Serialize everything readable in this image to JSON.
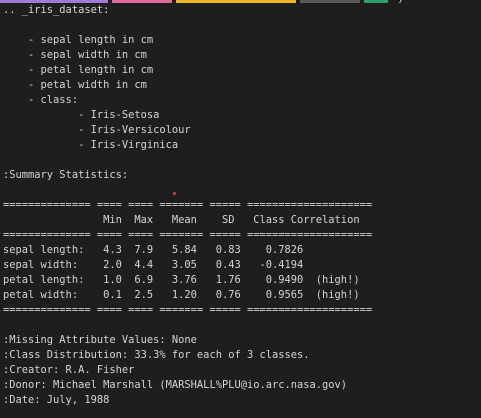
{
  "theme": {
    "background": "#1e1e1e",
    "text": "#d4d4d4",
    "marker": "#e03c3c",
    "tab_colors": [
      "#9d7cd8",
      "#e06c9f",
      "#f0b429",
      "#5a5a5a",
      "#2e9e6b"
    ]
  },
  "tab_strip": {
    "glyph": "y"
  },
  "output": {
    "lines": [
      ".. _iris_dataset:",
      "",
      "    - sepal length in cm",
      "    - sepal width in cm",
      "    - petal length in cm",
      "    - petal width in cm",
      "    - class:",
      "            - Iris-Setosa",
      "            - Iris-Versicolour",
      "            - Iris-Virginica",
      "",
      ":Summary Statistics:",
      "",
      "============== ==== ==== ======= ===== ====================",
      "                Min  Max   Mean    SD   Class Correlation",
      "============== ==== ==== ======= ===== ====================",
      "sepal length:   4.3  7.9   5.84   0.83    0.7826",
      "sepal width:    2.0  4.4   3.05   0.43   -0.4194",
      "petal length:   1.0  6.9   3.76   1.76    0.9490  (high!)",
      "petal width:    0.1  2.5   1.20   0.76    0.9565  (high!)",
      "============== ==== ==== ======= ===== ====================",
      "",
      ":Missing Attribute Values: None",
      ":Class Distribution: 33.3% for each of 3 classes.",
      ":Creator: R.A. Fisher",
      ":Donor: Michael Marshall (MARSHALL%PLU@io.arc.nasa.gov)",
      ":Date: July, 1988"
    ]
  }
}
